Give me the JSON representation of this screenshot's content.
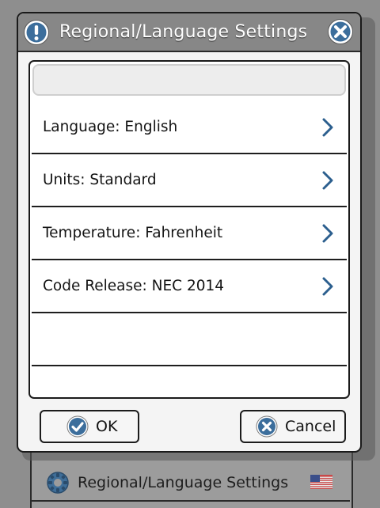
{
  "dialog": {
    "title": "Regional/Language Settings",
    "title_icon": "info-icon",
    "close_icon": "close-icon"
  },
  "search": {
    "value": "",
    "placeholder": ""
  },
  "settings": {
    "items": [
      {
        "label": "Language: English",
        "icon": "chevron-right-icon"
      },
      {
        "label": "Units: Standard",
        "icon": "chevron-right-icon"
      },
      {
        "label": "Temperature: Fahrenheit",
        "icon": "chevron-right-icon"
      },
      {
        "label": "Code Release: NEC 2014",
        "icon": "chevron-right-icon"
      }
    ]
  },
  "buttons": {
    "ok_label": "OK",
    "ok_icon": "check-circle-icon",
    "cancel_label": "Cancel",
    "cancel_icon": "x-circle-icon"
  },
  "background": {
    "row_label": "Regional/Language Settings",
    "row_icon": "gear-icon",
    "flag_icon": "us-flag-icon"
  },
  "colors": {
    "accent_blue": "#2c5f8e",
    "titlebar": "#878787",
    "icon_blue": "#3c6e9c"
  }
}
